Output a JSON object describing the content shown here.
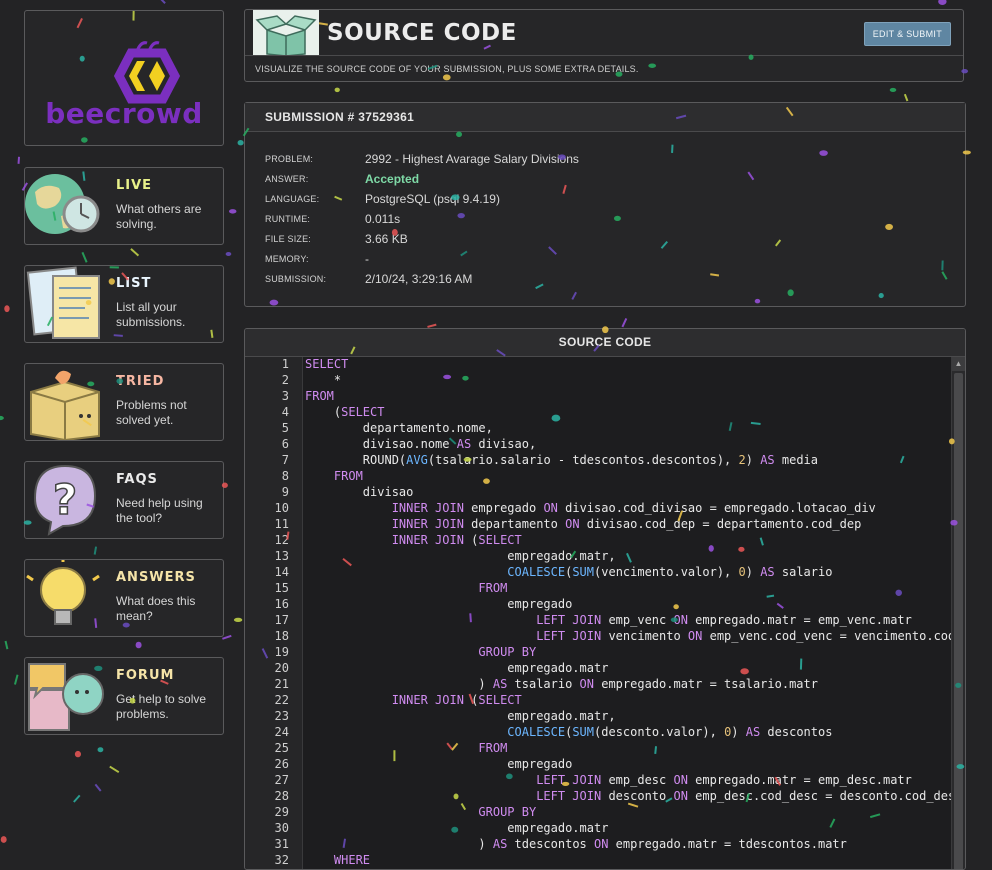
{
  "sidebar": {
    "logo_text": "beecrowd",
    "items": [
      {
        "title": "LIVE",
        "desc": "What others are solving.",
        "color": "#e8f18a"
      },
      {
        "title": "LIST",
        "desc": "List all your submissions.",
        "color": "#eaf6ff"
      },
      {
        "title": "TRIED",
        "desc": "Problems not solved yet.",
        "color": "#f7b7a3"
      },
      {
        "title": "FAQS",
        "desc": "Need help using the tool?",
        "color": "#eaeaea"
      },
      {
        "title": "ANSWERS",
        "desc": "What does this mean?",
        "color": "#f5e4a8"
      },
      {
        "title": "FORUM",
        "desc": "Get help to solve problems.",
        "color": "#f5e4a8"
      }
    ]
  },
  "header": {
    "title": "SOURCE CODE",
    "edit_label": "EDIT & SUBMIT",
    "subtitle": "VISUALIZE THE SOURCE CODE OF YOUR SUBMISSION, PLUS SOME EXTRA DETAILS."
  },
  "submission": {
    "title": "SUBMISSION # 37529361",
    "rows": [
      {
        "label": "PROBLEM:",
        "value": "2992 - Highest Avarage Salary Divisions"
      },
      {
        "label": "ANSWER:",
        "value": "Accepted"
      },
      {
        "label": "LANGUAGE:",
        "value": "PostgreSQL (psql 9.4.19)"
      },
      {
        "label": "RUNTIME:",
        "value": "0.011s"
      },
      {
        "label": "FILE SIZE:",
        "value": "3.66 KB"
      },
      {
        "label": "MEMORY:",
        "value": "-"
      },
      {
        "label": "SUBMISSION:",
        "value": "2/10/24, 3:29:16 AM"
      }
    ]
  },
  "code": {
    "title": "SOURCE CODE",
    "lines": [
      "SELECT",
      "    *",
      "FROM",
      "    (SELECT",
      "        departamento.nome,",
      "        divisao.nome AS divisao,",
      "        ROUND(AVG(tsalario.salario - tdescontos.descontos), 2) AS media",
      "    FROM",
      "        divisao",
      "            INNER JOIN empregado ON divisao.cod_divisao = empregado.lotacao_div",
      "            INNER JOIN departamento ON divisao.cod_dep = departamento.cod_dep",
      "            INNER JOIN (SELECT",
      "                            empregado.matr,",
      "                            COALESCE(SUM(vencimento.valor), 0) AS salario",
      "                        FROM",
      "                            empregado",
      "                                LEFT JOIN emp_venc ON empregado.matr = emp_venc.matr",
      "                                LEFT JOIN vencimento ON emp_venc.cod_venc = vencimento.cod_venc",
      "                        GROUP BY",
      "                            empregado.matr",
      "                        ) AS tsalario ON empregado.matr = tsalario.matr",
      "            INNER JOIN (SELECT",
      "                            empregado.matr,",
      "                            COALESCE(SUM(desconto.valor), 0) AS descontos",
      "                        FROM",
      "                            empregado",
      "                                LEFT JOIN emp_desc ON empregado.matr = emp_desc.matr",
      "                                LEFT JOIN desconto ON emp_desc.cod_desc = desconto.cod_desc",
      "                        GROUP BY",
      "                            empregado.matr",
      "                        ) AS tdescontos ON empregado.matr = tdescontos.matr",
      "    WHERE"
    ]
  }
}
